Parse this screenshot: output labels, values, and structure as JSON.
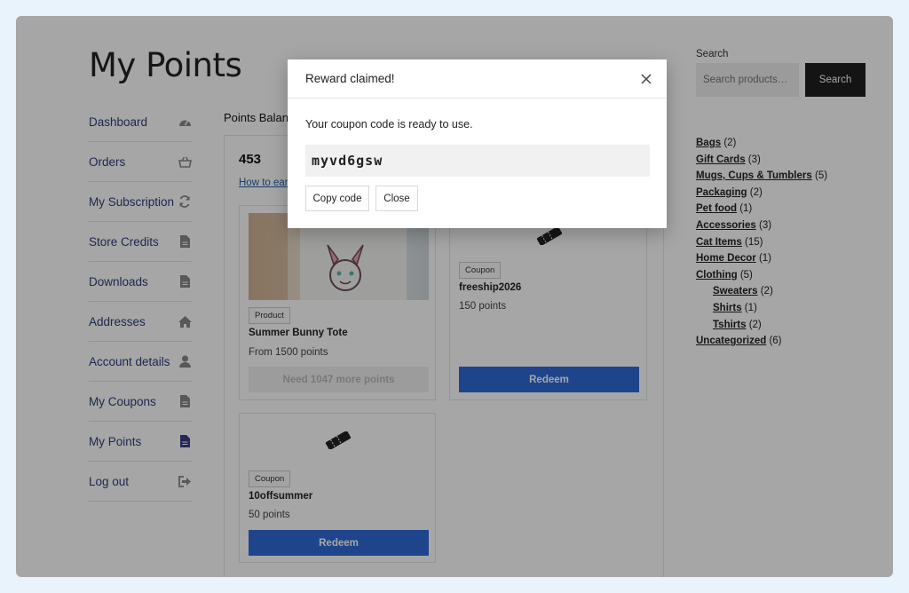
{
  "page": {
    "title": "My Points"
  },
  "nav": {
    "items": [
      {
        "label": "Dashboard",
        "icon": "dashboard-icon"
      },
      {
        "label": "Orders",
        "icon": "basket-icon"
      },
      {
        "label": "My Subscription",
        "icon": "refresh-icon"
      },
      {
        "label": "Store Credits",
        "icon": "file-icon"
      },
      {
        "label": "Downloads",
        "icon": "file-icon"
      },
      {
        "label": "Addresses",
        "icon": "home-icon"
      },
      {
        "label": "Account details",
        "icon": "user-icon"
      },
      {
        "label": "My Coupons",
        "icon": "file-icon"
      },
      {
        "label": "My Points",
        "icon": "file-icon",
        "active": true
      },
      {
        "label": "Log out",
        "icon": "logout-icon"
      }
    ]
  },
  "points": {
    "balance_label": "Points Balance",
    "balance": "453",
    "how_to_earn": "How to earn"
  },
  "cards": [
    {
      "badge": "Product",
      "title": "Summer Bunny Tote",
      "points": "From 1500 points",
      "button": "Need 1047 more points",
      "enabled": false
    },
    {
      "badge": "Coupon",
      "title": "freeship2026",
      "points": "150 points",
      "button": "Redeem",
      "enabled": true
    },
    {
      "badge": "Coupon",
      "title": "10offsummer",
      "points": "50 points",
      "button": "Redeem",
      "enabled": true
    }
  ],
  "search": {
    "label": "Search",
    "placeholder": "Search products…",
    "button": "Search"
  },
  "categories": [
    {
      "name": "Bags",
      "count": "(2)"
    },
    {
      "name": "Gift Cards",
      "count": "(3)"
    },
    {
      "name": "Mugs, Cups & Tumblers",
      "count": "(5)"
    },
    {
      "name": "Packaging",
      "count": "(2)"
    },
    {
      "name": "Pet food",
      "count": "(1)"
    },
    {
      "name": "Accessories",
      "count": "(3)"
    },
    {
      "name": "Cat Items",
      "count": "(15)"
    },
    {
      "name": "Home Decor",
      "count": "(1)"
    },
    {
      "name": "Clothing",
      "count": "(5)"
    },
    {
      "name": "Sweaters",
      "count": "(2)",
      "sub": true
    },
    {
      "name": "Shirts",
      "count": "(1)",
      "sub": true
    },
    {
      "name": "Tshirts",
      "count": "(2)",
      "sub": true
    },
    {
      "name": "Uncategorized",
      "count": "(6)"
    }
  ],
  "modal": {
    "title": "Reward claimed!",
    "message": "Your coupon code is ready to use.",
    "code": "myvd6gsw",
    "copy_button": "Copy code",
    "close_button": "Close"
  },
  "colors": {
    "accent": "#2f6bd7",
    "link": "#2c3e7a",
    "overlay": "rgba(0,0,0,0.35)"
  }
}
